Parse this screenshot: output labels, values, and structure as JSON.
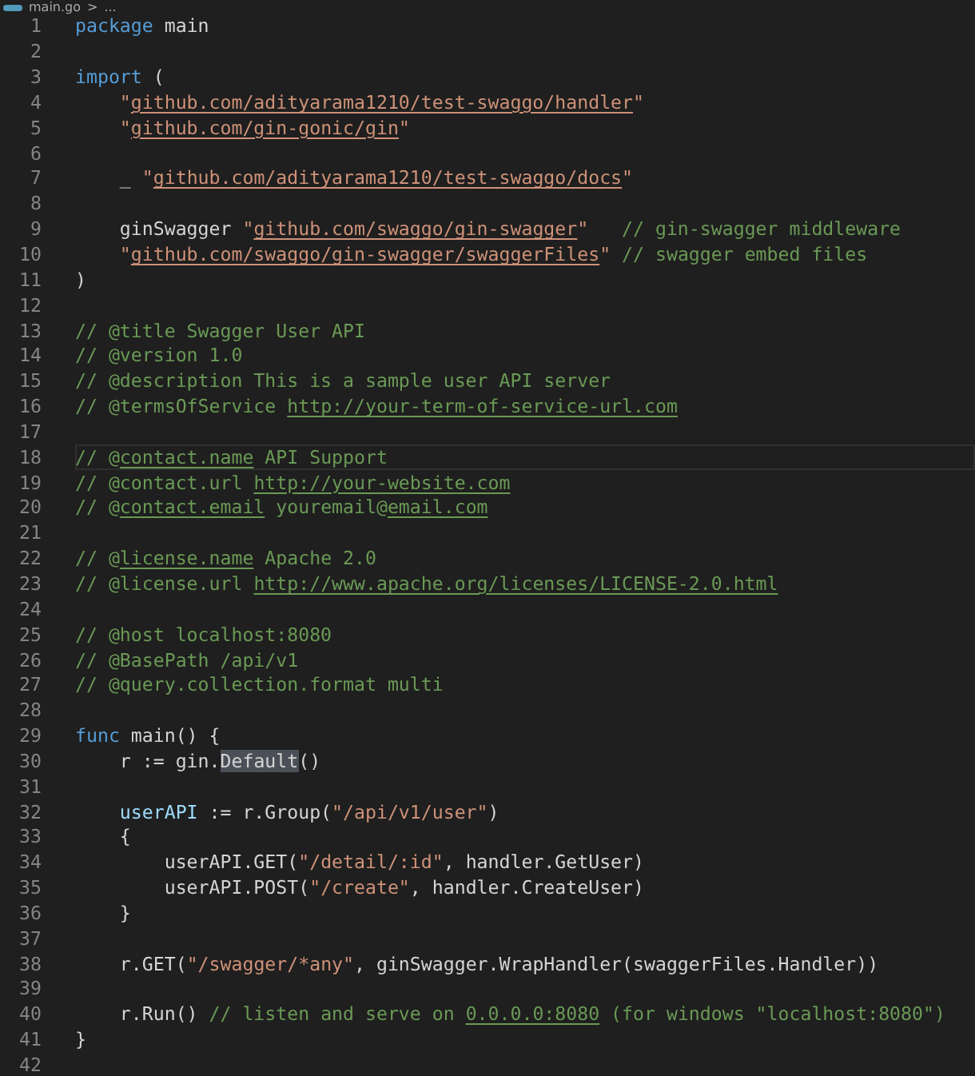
{
  "breadcrumb": {
    "file": "main.go",
    "separator": ">",
    "rest": "..."
  },
  "lines": [
    {
      "number": "1",
      "current": false,
      "tokens": [
        {
          "kind": "keyword",
          "text": "package"
        },
        {
          "kind": "plain",
          "text": " main"
        }
      ]
    },
    {
      "number": "2",
      "current": false
    },
    {
      "number": "3",
      "current": false,
      "tokens": [
        {
          "kind": "keyword",
          "text": "import"
        },
        {
          "kind": "plain",
          "text": " ("
        }
      ]
    },
    {
      "number": "4",
      "current": false,
      "tokens": [
        {
          "kind": "string",
          "text": "    \""
        },
        {
          "kind": "string_link",
          "text": "github.com/adityarama1210/test-swaggo/handler"
        },
        {
          "kind": "string",
          "text": "\""
        }
      ]
    },
    {
      "number": "5",
      "current": false,
      "tokens": [
        {
          "kind": "string",
          "text": "    \""
        },
        {
          "kind": "string_link",
          "text": "github.com/gin-gonic/gin"
        },
        {
          "kind": "string",
          "text": "\""
        }
      ]
    },
    {
      "number": "6",
      "current": false
    },
    {
      "number": "7",
      "current": false,
      "tokens": [
        {
          "kind": "plain",
          "text": "    _ "
        },
        {
          "kind": "string",
          "text": "\""
        },
        {
          "kind": "string_link",
          "text": "github.com/adityarama1210/test-swaggo/docs"
        },
        {
          "kind": "string",
          "text": "\""
        }
      ]
    },
    {
      "number": "8",
      "current": false
    },
    {
      "number": "9",
      "current": false,
      "tokens": [
        {
          "kind": "plain",
          "text": "    ginSwagger "
        },
        {
          "kind": "string",
          "text": "\""
        },
        {
          "kind": "string_link",
          "text": "github.com/swaggo/gin-swagger"
        },
        {
          "kind": "string",
          "text": "\""
        },
        {
          "kind": "comment",
          "text": "   // gin-swagger middleware"
        }
      ]
    },
    {
      "number": "10",
      "current": false,
      "tokens": [
        {
          "kind": "string",
          "text": "    \""
        },
        {
          "kind": "string_link",
          "text": "github.com/swaggo/gin-swagger/swaggerFiles"
        },
        {
          "kind": "string",
          "text": "\""
        },
        {
          "kind": "comment",
          "text": " // swagger embed files"
        }
      ]
    },
    {
      "number": "11",
      "current": false,
      "tokens": [
        {
          "kind": "plain",
          "text": ")"
        }
      ]
    },
    {
      "number": "12",
      "current": false
    },
    {
      "number": "13",
      "current": false,
      "tokens": [
        {
          "kind": "comment",
          "text": "// @title Swagger User API"
        }
      ]
    },
    {
      "number": "14",
      "current": false,
      "tokens": [
        {
          "kind": "comment",
          "text": "// @version 1.0"
        }
      ]
    },
    {
      "number": "15",
      "current": false,
      "tokens": [
        {
          "kind": "comment",
          "text": "// @description This is a sample user API server"
        }
      ]
    },
    {
      "number": "16",
      "current": false,
      "tokens": [
        {
          "kind": "comment",
          "text": "// @termsOfService "
        },
        {
          "kind": "comment_link",
          "text": "http://your-term-of-service-url.com"
        }
      ]
    },
    {
      "number": "17",
      "current": false
    },
    {
      "number": "18",
      "current": true,
      "tokens": [
        {
          "kind": "comment",
          "text": "// @"
        },
        {
          "kind": "comment_link",
          "text": "contact.name"
        },
        {
          "kind": "comment",
          "text": " API Support"
        }
      ]
    },
    {
      "number": "19",
      "current": false,
      "tokens": [
        {
          "kind": "comment",
          "text": "// @contact.url "
        },
        {
          "kind": "comment_link",
          "text": "http://your-website.com"
        }
      ]
    },
    {
      "number": "20",
      "current": false,
      "tokens": [
        {
          "kind": "comment",
          "text": "// @"
        },
        {
          "kind": "comment_link",
          "text": "contact.email"
        },
        {
          "kind": "comment",
          "text": " youremail@"
        },
        {
          "kind": "comment_link",
          "text": "email.com"
        }
      ]
    },
    {
      "number": "21",
      "current": false
    },
    {
      "number": "22",
      "current": false,
      "tokens": [
        {
          "kind": "comment",
          "text": "// @"
        },
        {
          "kind": "comment_link",
          "text": "license.name"
        },
        {
          "kind": "comment",
          "text": " Apache 2.0"
        }
      ]
    },
    {
      "number": "23",
      "current": false,
      "tokens": [
        {
          "kind": "comment",
          "text": "// @license.url "
        },
        {
          "kind": "comment_link",
          "text": "http://www.apache.org/licenses/LICENSE-2.0.html"
        }
      ]
    },
    {
      "number": "24",
      "current": false
    },
    {
      "number": "25",
      "current": false,
      "tokens": [
        {
          "kind": "comment",
          "text": "// @host localhost:8080"
        }
      ]
    },
    {
      "number": "26",
      "current": false,
      "tokens": [
        {
          "kind": "comment",
          "text": "// @BasePath /api/v1"
        }
      ]
    },
    {
      "number": "27",
      "current": false,
      "tokens": [
        {
          "kind": "comment",
          "text": "// @query.collection.format multi"
        }
      ]
    },
    {
      "number": "28",
      "current": false
    },
    {
      "number": "29",
      "current": false,
      "tokens": [
        {
          "kind": "keyword",
          "text": "func"
        },
        {
          "kind": "plain",
          "text": " main() {"
        }
      ]
    },
    {
      "number": "30",
      "current": false,
      "tokens": [
        {
          "kind": "plain",
          "text": "    r := gin."
        },
        {
          "kind": "highlight",
          "text": "Default"
        },
        {
          "kind": "plain",
          "text": "()"
        }
      ]
    },
    {
      "number": "31",
      "current": false
    },
    {
      "number": "32",
      "current": false,
      "tokens": [
        {
          "kind": "variable",
          "text": "    userAPI"
        },
        {
          "kind": "plain",
          "text": " := r.Group("
        },
        {
          "kind": "string",
          "text": "\"/api/v1/user\""
        },
        {
          "kind": "plain",
          "text": ")"
        }
      ]
    },
    {
      "number": "33",
      "current": false,
      "tokens": [
        {
          "kind": "plain",
          "text": "    {"
        }
      ]
    },
    {
      "number": "34",
      "current": false,
      "tokens": [
        {
          "kind": "plain",
          "text": "        userAPI.GET("
        },
        {
          "kind": "string",
          "text": "\"/detail/:id\""
        },
        {
          "kind": "plain",
          "text": ", handler.GetUser)"
        }
      ]
    },
    {
      "number": "35",
      "current": false,
      "tokens": [
        {
          "kind": "plain",
          "text": "        userAPI.POST("
        },
        {
          "kind": "string",
          "text": "\"/create\""
        },
        {
          "kind": "plain",
          "text": ", handler.CreateUser)"
        }
      ]
    },
    {
      "number": "36",
      "current": false,
      "tokens": [
        {
          "kind": "plain",
          "text": "    }"
        }
      ]
    },
    {
      "number": "37",
      "current": false
    },
    {
      "number": "38",
      "current": false,
      "tokens": [
        {
          "kind": "plain",
          "text": "    r.GET("
        },
        {
          "kind": "string",
          "text": "\"/swagger/*any\""
        },
        {
          "kind": "plain",
          "text": ", ginSwagger.WrapHandler(swaggerFiles.Handler))"
        }
      ]
    },
    {
      "number": "39",
      "current": false
    },
    {
      "number": "40",
      "current": false,
      "tokens": [
        {
          "kind": "plain",
          "text": "    r.Run() "
        },
        {
          "kind": "comment",
          "text": "// listen and serve on "
        },
        {
          "kind": "comment_link",
          "text": "0.0.0.0:8080"
        },
        {
          "kind": "comment",
          "text": " (for windows \"localhost:8080\")"
        }
      ]
    },
    {
      "number": "41",
      "current": false,
      "tokens": [
        {
          "kind": "plain",
          "text": "}"
        }
      ]
    },
    {
      "number": "42",
      "current": false
    }
  ]
}
